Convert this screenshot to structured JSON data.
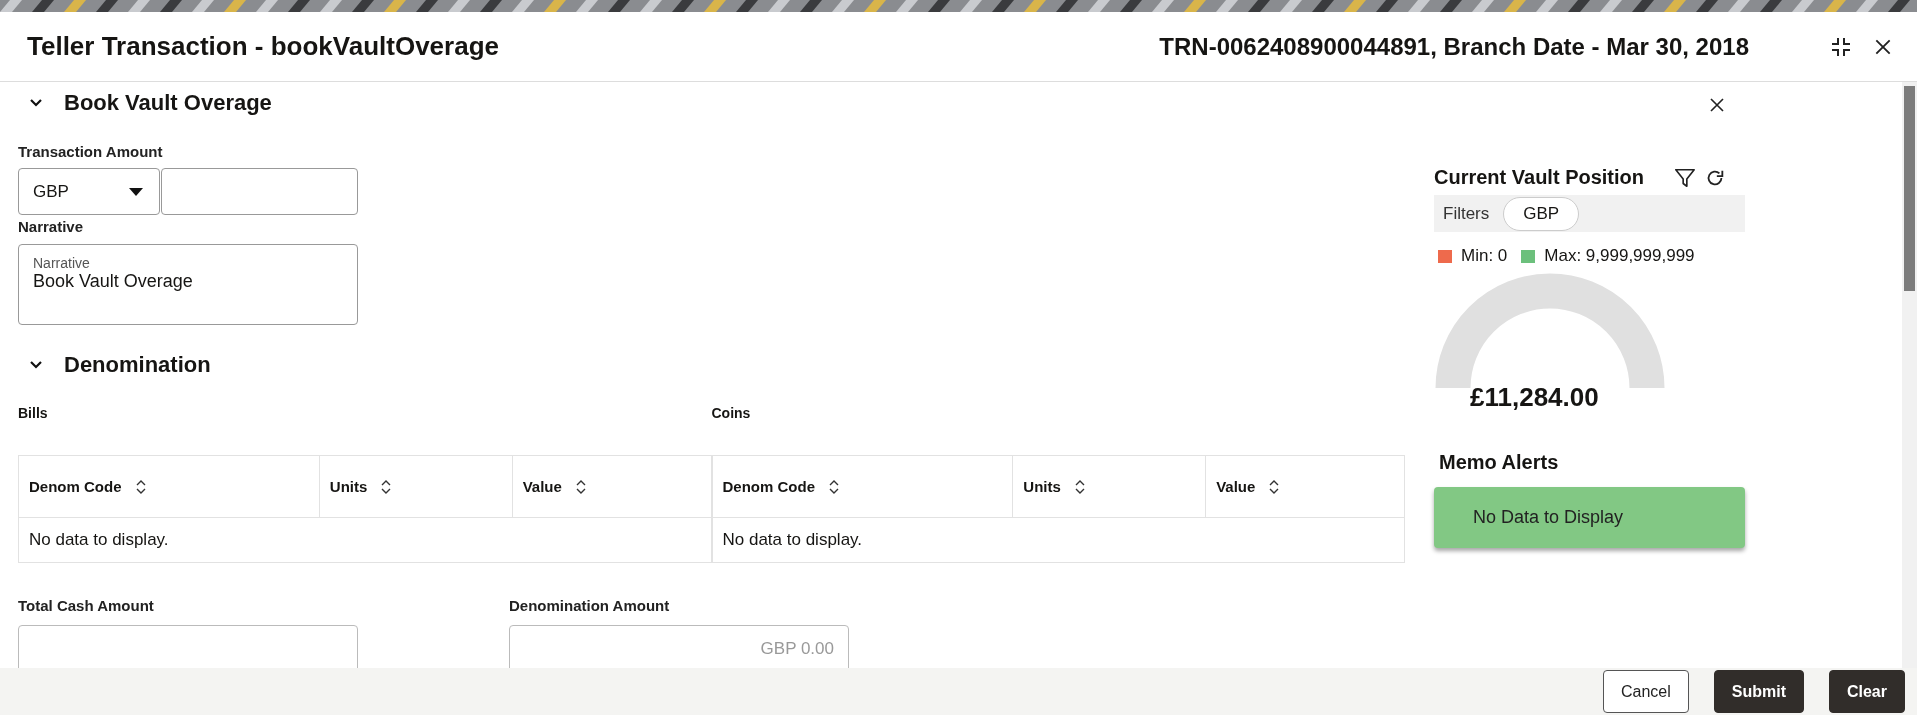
{
  "window": {
    "title": "Teller Transaction - bookVaultOverage",
    "reference": "TRN-0062408900044891, Branch Date - Mar 30, 2018"
  },
  "book_vault_overage": {
    "heading": "Book Vault Overage",
    "expanded": true,
    "transaction_amount": {
      "label": "Transaction Amount",
      "currency": "GBP"
    },
    "narrative": {
      "label": "Narrative",
      "floating_label": "Narrative",
      "value": "Book Vault Overage"
    }
  },
  "denomination": {
    "heading": "Denomination",
    "expanded": true,
    "tables": [
      {
        "title": "Bills",
        "columns": [
          "Denom Code",
          "Units",
          "Value"
        ],
        "empty_message": "No data to display."
      },
      {
        "title": "Coins",
        "columns": [
          "Denom Code",
          "Units",
          "Value"
        ],
        "empty_message": "No data to display."
      }
    ]
  },
  "totals": [
    {
      "label": "Total Cash Amount",
      "kind": "text"
    },
    {
      "label": "Denomination Amount",
      "kind": "amount",
      "value": "GBP 0.00"
    }
  ],
  "vault_position": {
    "title": "Current Vault Position",
    "filters_label": "Filters",
    "filter_chip": "GBP",
    "legend": [
      {
        "label": "Min: 0",
        "color": "#ee6a4c"
      },
      {
        "label": "Max: 9,999,999,999",
        "color": "#6cc07c"
      }
    ],
    "amount": "£11,284.00"
  },
  "memo_alerts": {
    "title": "Memo Alerts",
    "message": "No Data to Display"
  },
  "buttons": [
    {
      "label": "Cancel",
      "kind": "secondary"
    },
    {
      "label": "Submit",
      "kind": "primary"
    },
    {
      "label": "Clear",
      "kind": "primary"
    }
  ]
}
